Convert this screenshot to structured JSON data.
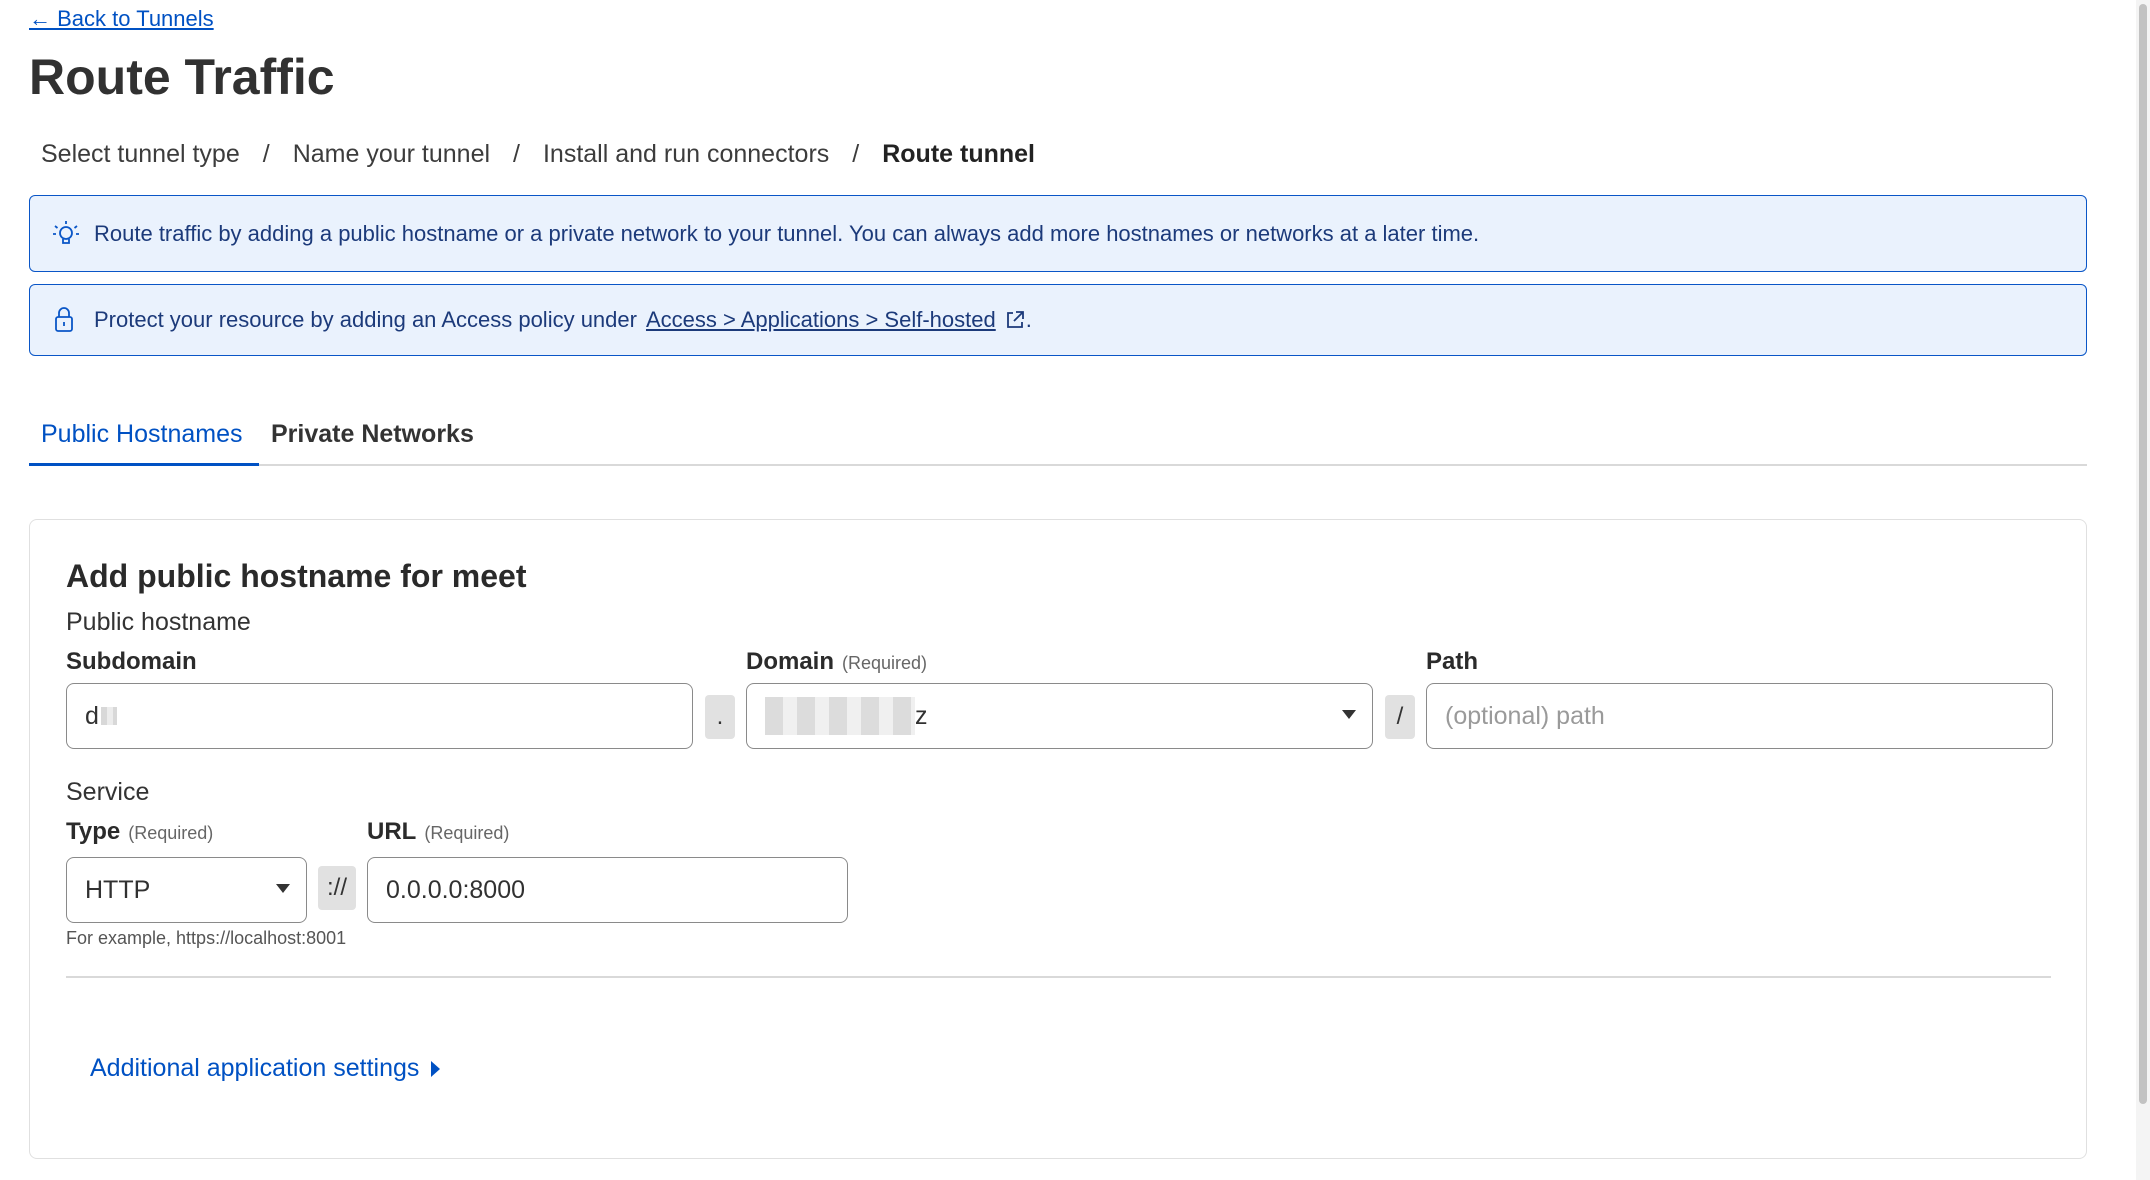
{
  "nav": {
    "back_label": "← Back to Tunnels"
  },
  "page": {
    "title": "Route Traffic"
  },
  "breadcrumb": {
    "steps": [
      "Select tunnel type",
      "Name your tunnel",
      "Install and run connectors",
      "Route tunnel"
    ],
    "separator": "/"
  },
  "banners": {
    "info": {
      "icon": "lightbulb-icon",
      "text": "Route traffic by adding a public hostname or a private network to your tunnel. You can always add more hostnames or networks at a later time."
    },
    "access": {
      "icon": "lock-icon",
      "text_before": "Protect your resource by adding an Access policy under",
      "link": "Access > Applications > Self-hosted",
      "link_icon": "external-link-icon",
      "text_after": "."
    }
  },
  "tabs": [
    {
      "label": "Public Hostnames",
      "active": true
    },
    {
      "label": "Private Networks",
      "active": false
    }
  ],
  "form": {
    "title": "Add public hostname for meet",
    "public_hostname_label": "Public hostname",
    "subdomain": {
      "label": "Subdomain",
      "value": "d"
    },
    "dot_joiner": ".",
    "domain": {
      "label": "Domain",
      "required": "(Required)",
      "value_suffix": "z"
    },
    "slash_joiner": "/",
    "path": {
      "label": "Path",
      "placeholder": "(optional) path"
    },
    "service_label": "Service",
    "type": {
      "label": "Type",
      "required": "(Required)",
      "value": "HTTP"
    },
    "scheme_joiner": "://",
    "url": {
      "label": "URL",
      "required": "(Required)",
      "value": "0.0.0.0:8000"
    },
    "example_text": "For example, https://localhost:8001",
    "additional_settings": "Additional application settings"
  },
  "colors": {
    "accent": "#0051c3",
    "banner_bg": "#eaf2fd",
    "banner_border": "#0a56c7"
  }
}
